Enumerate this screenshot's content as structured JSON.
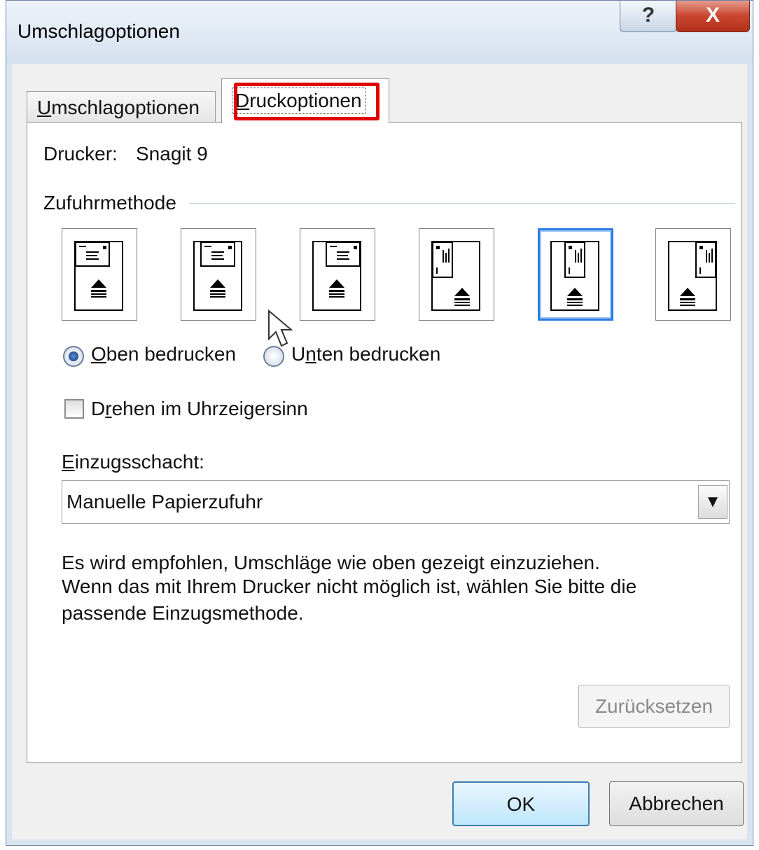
{
  "window": {
    "title": "Umschlagoptionen",
    "help_glyph": "?",
    "close_glyph": "X"
  },
  "tabs": [
    {
      "label": "Umschlagoptionen",
      "accel": "U",
      "rest": "mschlagoptionen",
      "active": false
    },
    {
      "label": "Druckoptionen",
      "accel": "D",
      "rest": "ruckoptionen",
      "active": true
    }
  ],
  "printer": {
    "label": "Drucker:",
    "name": "Snagit 9"
  },
  "feed_method": {
    "group_label": "Zufuhrmethode",
    "options": [
      {
        "orientation": "landscape",
        "position": "left",
        "selected": false
      },
      {
        "orientation": "landscape",
        "position": "center",
        "selected": false
      },
      {
        "orientation": "landscape",
        "position": "right",
        "selected": false
      },
      {
        "orientation": "portrait",
        "position": "left",
        "selected": false
      },
      {
        "orientation": "portrait",
        "position": "center",
        "selected": true
      },
      {
        "orientation": "portrait",
        "position": "right",
        "selected": false
      }
    ]
  },
  "print_side": {
    "top": {
      "label": "Oben bedrucken",
      "accel": "O",
      "rest": "ben bedrucken",
      "checked": true
    },
    "bottom": {
      "label": "Unten bedrucken",
      "pre": "U",
      "accel": "n",
      "rest": "ten bedrucken",
      "checked": false
    }
  },
  "rotate": {
    "label": "Drehen im Uhrzeigersinn",
    "pre": "D",
    "accel": "r",
    "rest": "ehen im Uhrzeigersinn",
    "checked": false
  },
  "tray": {
    "label": "Einzugsschacht:",
    "accel": "E",
    "rest": "inzugsschacht:",
    "value": "Manuelle Papierzufuhr"
  },
  "info": {
    "line1": "Es wird empfohlen, Umschläge wie oben gezeigt einzuziehen.",
    "line2": "Wenn das mit Ihrem Drucker nicht möglich ist, wählen Sie bitte die",
    "line3": "passende Einzugsmethode."
  },
  "buttons": {
    "reset": "Zurücksetzen",
    "ok": "OK",
    "cancel": "Abbrechen"
  },
  "colors": {
    "highlight_red": "#e00000",
    "selection_blue": "#2a7de1"
  }
}
